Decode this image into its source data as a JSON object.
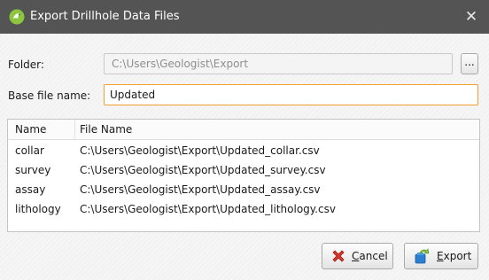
{
  "window": {
    "title": "Export Drillhole Data Files",
    "close_glyph": "✕",
    "app_icon": "leapfrog-app-icon"
  },
  "form": {
    "folder_label": "Folder:",
    "folder_value": "C:\\Users\\Geologist\\Export",
    "browse_label": "...",
    "basename_label": "Base file name:",
    "basename_value": "Updated"
  },
  "table": {
    "columns": [
      "Name",
      "File Name"
    ],
    "rows": [
      {
        "name": "collar",
        "file": "C:\\Users\\Geologist\\Export\\Updated_collar.csv"
      },
      {
        "name": "survey",
        "file": "C:\\Users\\Geologist\\Export\\Updated_survey.csv"
      },
      {
        "name": "assay",
        "file": "C:\\Users\\Geologist\\Export\\Updated_assay.csv"
      },
      {
        "name": "lithology",
        "file": "C:\\Users\\Geologist\\Export\\Updated_lithology.csv"
      }
    ]
  },
  "buttons": {
    "cancel_label": "Cancel",
    "export_label": "Export",
    "cancel_icon": "red-x-icon",
    "export_icon": "export-icon"
  },
  "colors": {
    "titlebar": "#545454",
    "focus_border": "#f0a030",
    "cancel_red": "#d8352b",
    "export_blue": "#2a7fd0"
  }
}
